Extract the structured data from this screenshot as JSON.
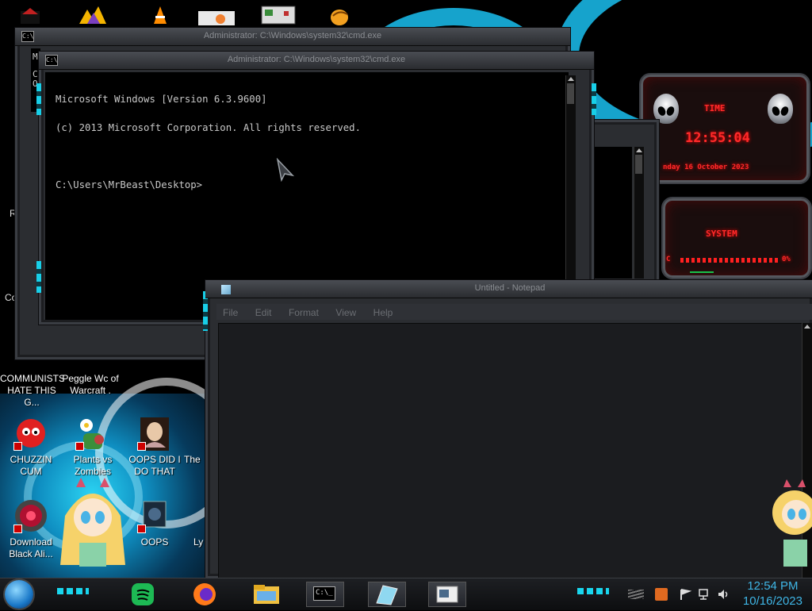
{
  "top_icons": [
    "warcraft-icon",
    "vlc-icon",
    "pidgin-icon",
    "program-icon",
    "mozilla-icon"
  ],
  "desktop": {
    "icons": [
      {
        "label": "COMMUNISTS HATE THIS G...",
        "icon": "shortcut-icon"
      },
      {
        "label": "Peggle Wc of Warcraft .",
        "icon": "shortcut-icon"
      },
      {
        "label": "CHUZZIN CUM",
        "icon": "chuzzle-icon"
      },
      {
        "label": "Plants vs Zombies",
        "icon": "plants-vs-zombies-icon"
      },
      {
        "label": "OOPS DID I DO THAT",
        "icon": "portrait-icon"
      },
      {
        "label": "The",
        "icon": "shortcut-icon"
      },
      {
        "label": "Download Black Ali...",
        "icon": "alienware-icon"
      },
      {
        "label": "OOPS",
        "icon": "oops-icon"
      },
      {
        "label": "Ly",
        "icon": "shortcut-icon"
      }
    ],
    "partial_left": [
      "M",
      "C",
      "O",
      "R",
      "Co"
    ]
  },
  "cmd_back": {
    "title": "Administrator: C:\\Windows\\system32\\cmd.exe"
  },
  "cmd_front": {
    "title": "Administrator: C:\\Windows\\system32\\cmd.exe",
    "lines": [
      "Microsoft Windows [Version 6.3.9600]",
      "(c) 2013 Microsoft Corporation. All rights reserved.",
      "",
      "C:\\Users\\MrBeast\\Desktop>"
    ]
  },
  "notepad": {
    "title": "Untitled - Notepad",
    "menu": [
      "File",
      "Edit",
      "Format",
      "View",
      "Help"
    ],
    "content": ""
  },
  "gadget": {
    "time_label": "TIME",
    "time": "12:55:04",
    "date": "nday 16 October 2023",
    "system_label": "SYSTEM",
    "cpu_marker": "C",
    "percent": "0%"
  },
  "taskbar": {
    "start_icon": "start-orb-icon",
    "pinned": [
      {
        "name": "spotify",
        "icon": "spotify-icon"
      },
      {
        "name": "firefox",
        "icon": "firefox-icon"
      },
      {
        "name": "file-explorer",
        "icon": "folder-icon"
      },
      {
        "name": "cmd",
        "icon": "cmd-icon",
        "label": "C:\\_"
      },
      {
        "name": "notepad",
        "icon": "notepad-icon"
      },
      {
        "name": "window",
        "icon": "window-icon"
      }
    ],
    "tray": [
      "app-tray-icon",
      "flag-icon",
      "network-icon",
      "speaker-icon"
    ],
    "time": "12:54 PM",
    "date": "10/16/2023"
  },
  "colors": {
    "accent": "#19d6ee",
    "clock": "#3fb6e6",
    "gadget_red": "#ff2a2a",
    "frame": "#2b2d31"
  }
}
